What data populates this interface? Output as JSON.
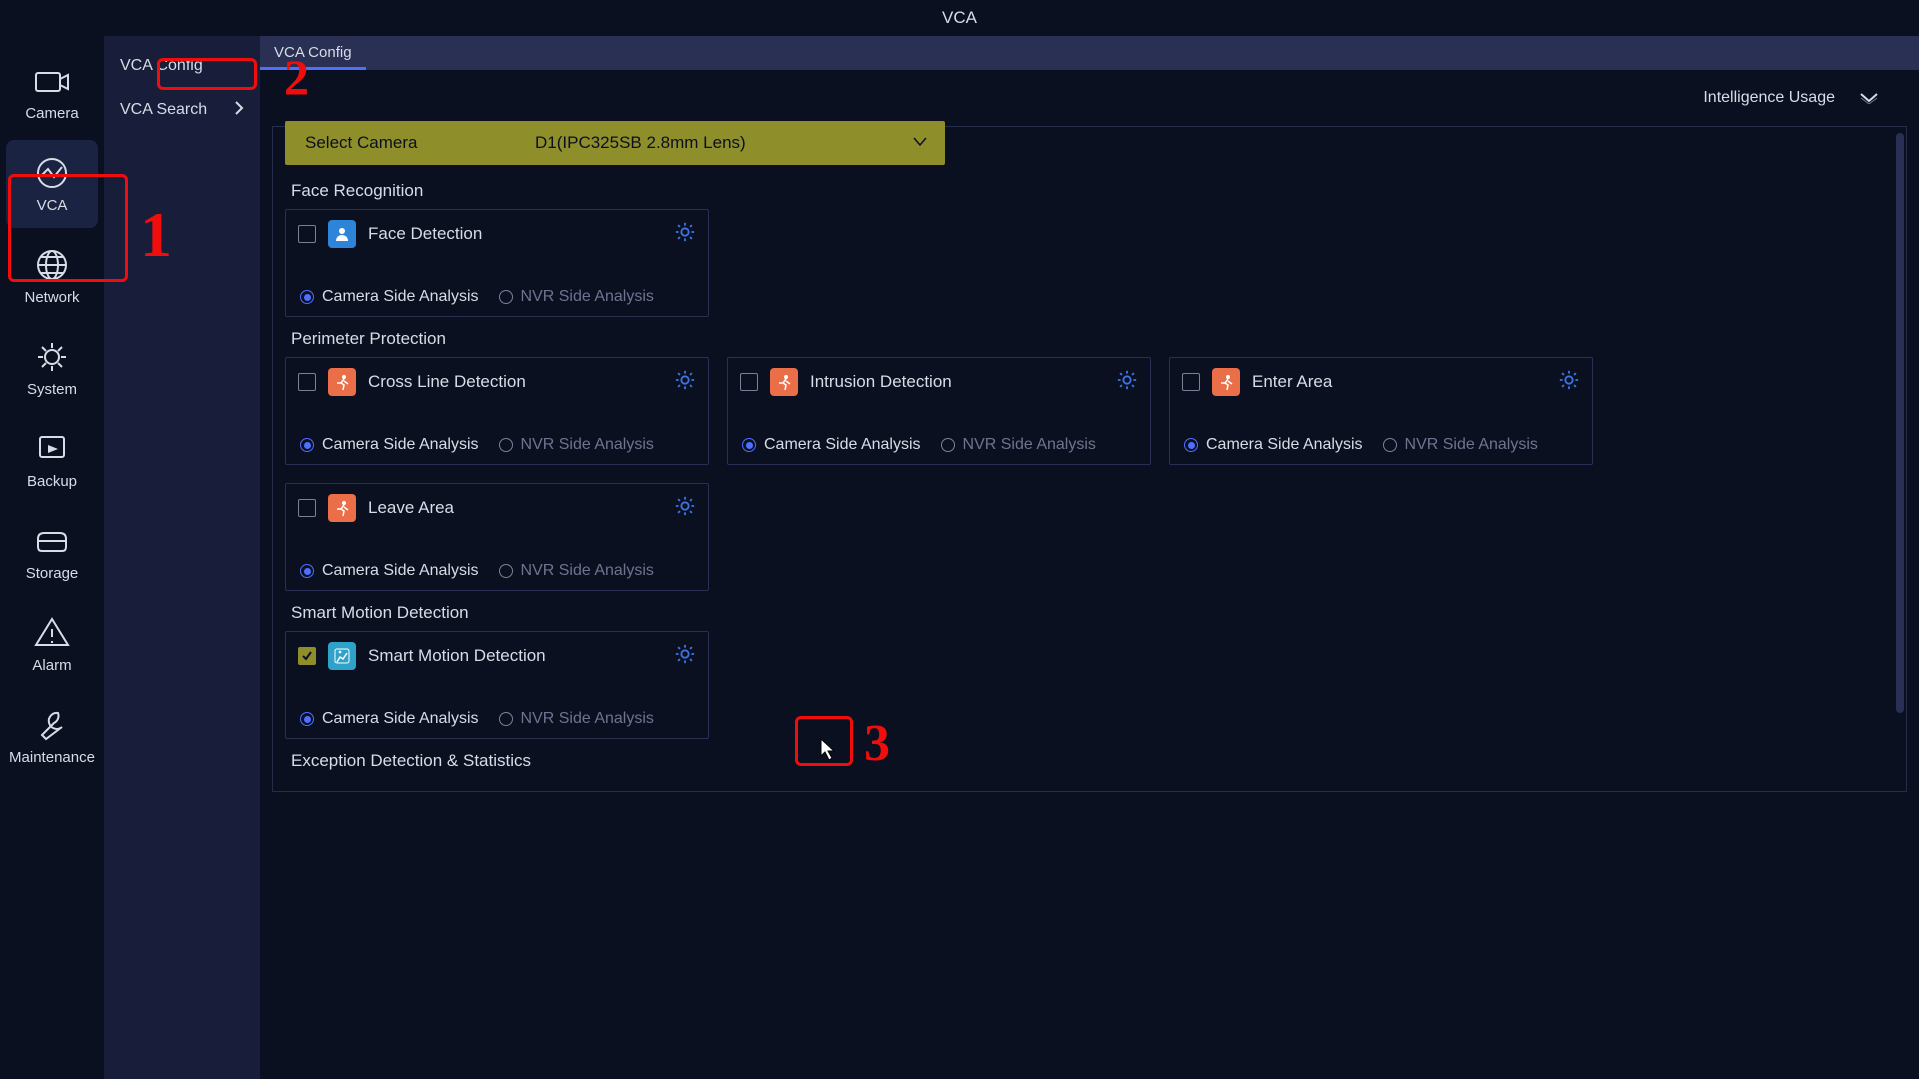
{
  "title": "VCA",
  "nav": [
    {
      "label": "Camera",
      "icon": "camera"
    },
    {
      "label": "VCA",
      "icon": "vca",
      "active": true
    },
    {
      "label": "Network",
      "icon": "network"
    },
    {
      "label": "System",
      "icon": "system"
    },
    {
      "label": "Backup",
      "icon": "backup"
    },
    {
      "label": "Storage",
      "icon": "storage"
    },
    {
      "label": "Alarm",
      "icon": "alarm"
    },
    {
      "label": "Maintenance",
      "icon": "maintenance"
    }
  ],
  "subnav": [
    {
      "label": "VCA Config",
      "expandable": false
    },
    {
      "label": "VCA Search",
      "expandable": true
    }
  ],
  "tabs": [
    {
      "label": "VCA Config",
      "active": true
    }
  ],
  "intel_label": "Intelligence Usage",
  "select_camera": {
    "label": "Select Camera",
    "value": "D1(IPC325SB 2.8mm Lens)"
  },
  "analysis": {
    "camera": "Camera Side Analysis",
    "nvr": "NVR Side Analysis"
  },
  "sections": [
    {
      "title": "Face Recognition",
      "cards": [
        {
          "name": "Face Detection",
          "color": "blue",
          "checked": false,
          "selected": "camera",
          "gear": true
        }
      ]
    },
    {
      "title": "Perimeter Protection",
      "cards": [
        {
          "name": "Cross Line Detection",
          "color": "orange",
          "checked": false,
          "selected": "camera",
          "gear": true
        },
        {
          "name": "Intrusion Detection",
          "color": "orange",
          "checked": false,
          "selected": "camera",
          "gear": true
        },
        {
          "name": "Enter Area",
          "color": "orange",
          "checked": false,
          "selected": "camera",
          "gear": true
        },
        {
          "name": "Leave Area",
          "color": "orange",
          "checked": false,
          "selected": "camera",
          "gear": true
        }
      ]
    },
    {
      "title": "Smart Motion Detection",
      "cards": [
        {
          "name": "Smart Motion Detection",
          "color": "motion",
          "checked": true,
          "selected": "camera",
          "gear": true,
          "gear_highlight": true
        }
      ]
    },
    {
      "title": "Exception Detection & Statistics",
      "cards": []
    }
  ],
  "annotations": {
    "n1": "1",
    "n2": "2",
    "n3": "3"
  }
}
